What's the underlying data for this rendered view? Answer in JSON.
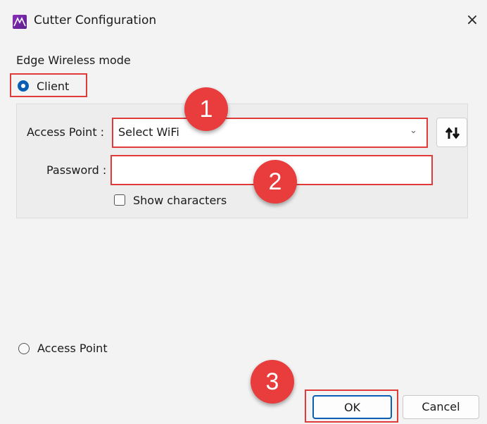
{
  "window": {
    "title": "Cutter Configuration",
    "close_glyph": "×",
    "icon": "app-logo-icon"
  },
  "mode_section": {
    "label": "Edge Wireless mode",
    "client_option": {
      "label": "Client",
      "selected": true
    },
    "access_point_option": {
      "label": "Access Point",
      "selected": false
    }
  },
  "client_settings": {
    "access_point_label": "Access Point :",
    "access_point_value": "Select WiFi",
    "refresh_icon": "refresh-arrows-icon",
    "password_label": "Password :",
    "password_value": "",
    "show_characters_label": "Show characters",
    "show_characters_checked": false
  },
  "buttons": {
    "ok": "OK",
    "cancel": "Cancel"
  },
  "annotations": {
    "step1": "1",
    "step2": "2",
    "step3": "3",
    "highlight_color": "#e03a3a",
    "badge_color": "#e93c3c"
  },
  "colors": {
    "accent": "#0a5fb4",
    "window_bg": "#f3f3f3"
  }
}
